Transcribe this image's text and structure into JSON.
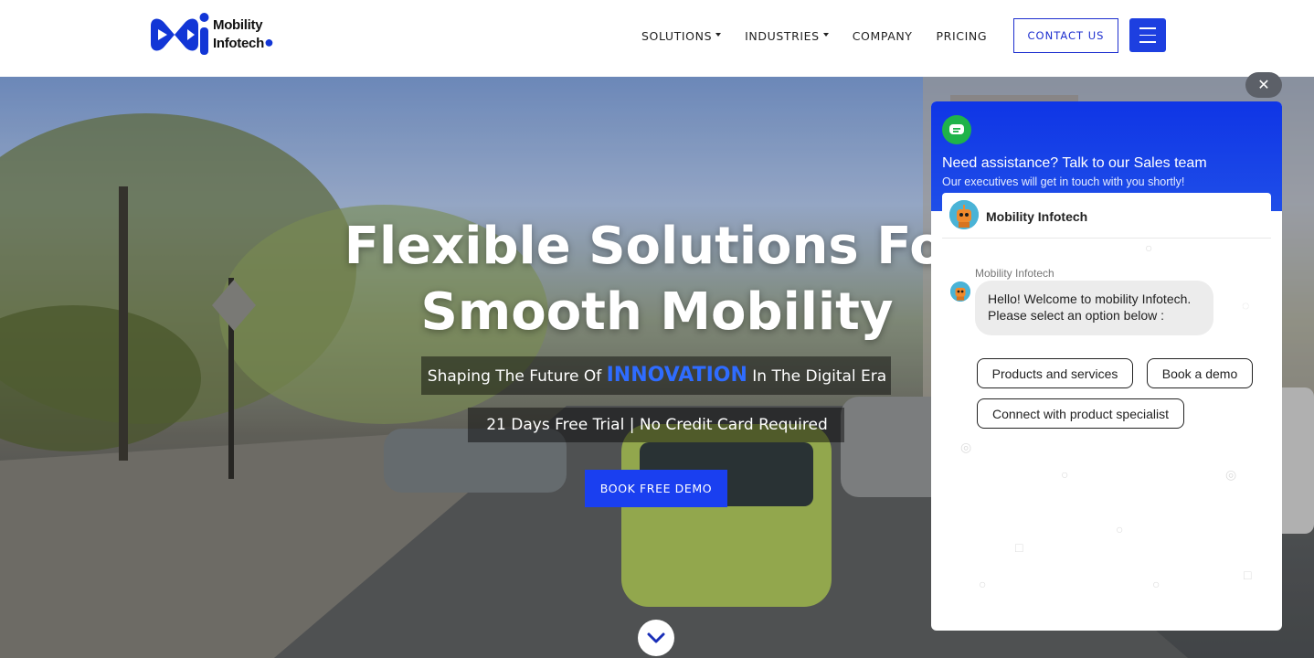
{
  "brand": {
    "line1": "Mobility",
    "line2": "Infotech",
    "accent": "#1236d6"
  },
  "nav": {
    "items": [
      {
        "label": "SOLUTIONS",
        "dropdown": true
      },
      {
        "label": "INDUSTRIES",
        "dropdown": true
      },
      {
        "label": "COMPANY",
        "dropdown": false
      },
      {
        "label": "PRICING",
        "dropdown": false
      }
    ],
    "contact_label": "CONTACT US",
    "menu_icon": "hamburger-icon"
  },
  "hero": {
    "title_line1": "Flexible Solutions For",
    "title_line2": "Smooth Mobility",
    "sub_before": "Shaping The Future Of ",
    "sub_accent": "INNOVATION",
    "sub_after": " In The Digital Era",
    "trial": "21 Days Free Trial | No Credit Card Required",
    "cta": "BOOK FREE DEMO",
    "scroll_icon": "chevron-down-icon"
  },
  "chat": {
    "close_glyph": "✕",
    "title": "Need assistance? Talk to our Sales team",
    "subtitle": "Our executives will get in touch with you shortly!",
    "agent_name": "Mobility Infotech",
    "message_sender": "Mobility Infotech",
    "message_line1": "Hello! Welcome to mobility Infotech.",
    "message_line2": "Please select an option below :",
    "options": [
      "Products and services",
      "Book a demo",
      "Connect with product specialist"
    ]
  },
  "colors": {
    "primary_blue": "#1a3ff0",
    "chat_header": "#0f35e6",
    "chat_badge_green": "#1fb34a",
    "accent_text": "#2f6cff"
  }
}
